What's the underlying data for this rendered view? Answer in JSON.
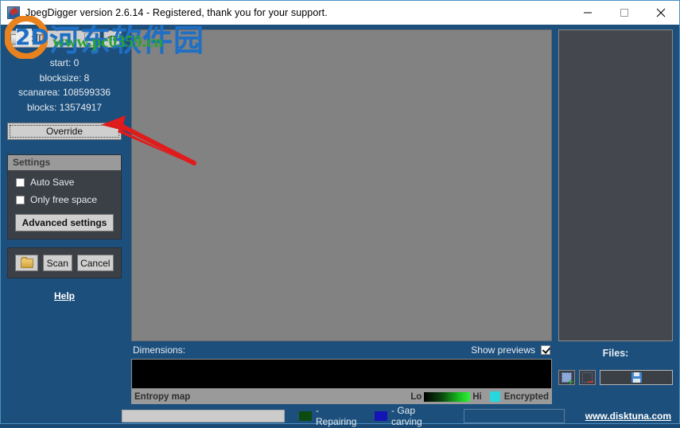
{
  "window": {
    "title": "JpegDigger version 2.6.14 - Registered, thank you for your support.",
    "app_icon": "jpegdigger-icon",
    "controls": {
      "minimize": "minimize-icon",
      "maximize": "maximize-icon",
      "close": "close-icon"
    }
  },
  "left_panel": {
    "drive": {
      "selected": "c: [D]",
      "icon": "drive-icon",
      "dropdown_arrow": "chevron-down-icon",
      "code_button": "<>"
    },
    "stats": [
      "start: 0",
      "blocksize: 8",
      "scanarea: 108599336",
      "blocks: 13574917"
    ],
    "override_label": "Override",
    "settings": {
      "title": "Settings",
      "checkboxes": [
        {
          "label": "Auto Save",
          "checked": false
        },
        {
          "label": "Only free space",
          "checked": false
        }
      ],
      "advanced_label": "Advanced settings"
    },
    "actions": {
      "folder_icon": "folder-icon",
      "scan_label": "Scan",
      "cancel_label": "Cancel"
    },
    "help_label": "Help"
  },
  "center_panel": {
    "dimensions_label": "Dimensions:",
    "show_previews_label": "Show previews",
    "show_previews_checked": true,
    "entropy_label": "Entropy map",
    "entropy_low": "Lo",
    "entropy_high": "Hi",
    "encrypted_label": "Encrypted",
    "encrypted_color": "#28d7dd"
  },
  "right_panel": {
    "files_label": "Files:",
    "select_all_icon": "select-all-icon",
    "select_none_icon": "select-none-icon",
    "save_icon": "floppy-save-icon"
  },
  "status_bar": {
    "repairing_label": "- Repairing",
    "repairing_color": "#0d4a10",
    "gap_carving_label": "- Gap carving",
    "gap_carving_color": "#1414b4",
    "site_link": "www.disktuna.com",
    "progress_value": 0
  },
  "watermark": {
    "brand_text": "河东软件园",
    "url_text": "www.pc0359.cn",
    "logo_text": "2D"
  }
}
